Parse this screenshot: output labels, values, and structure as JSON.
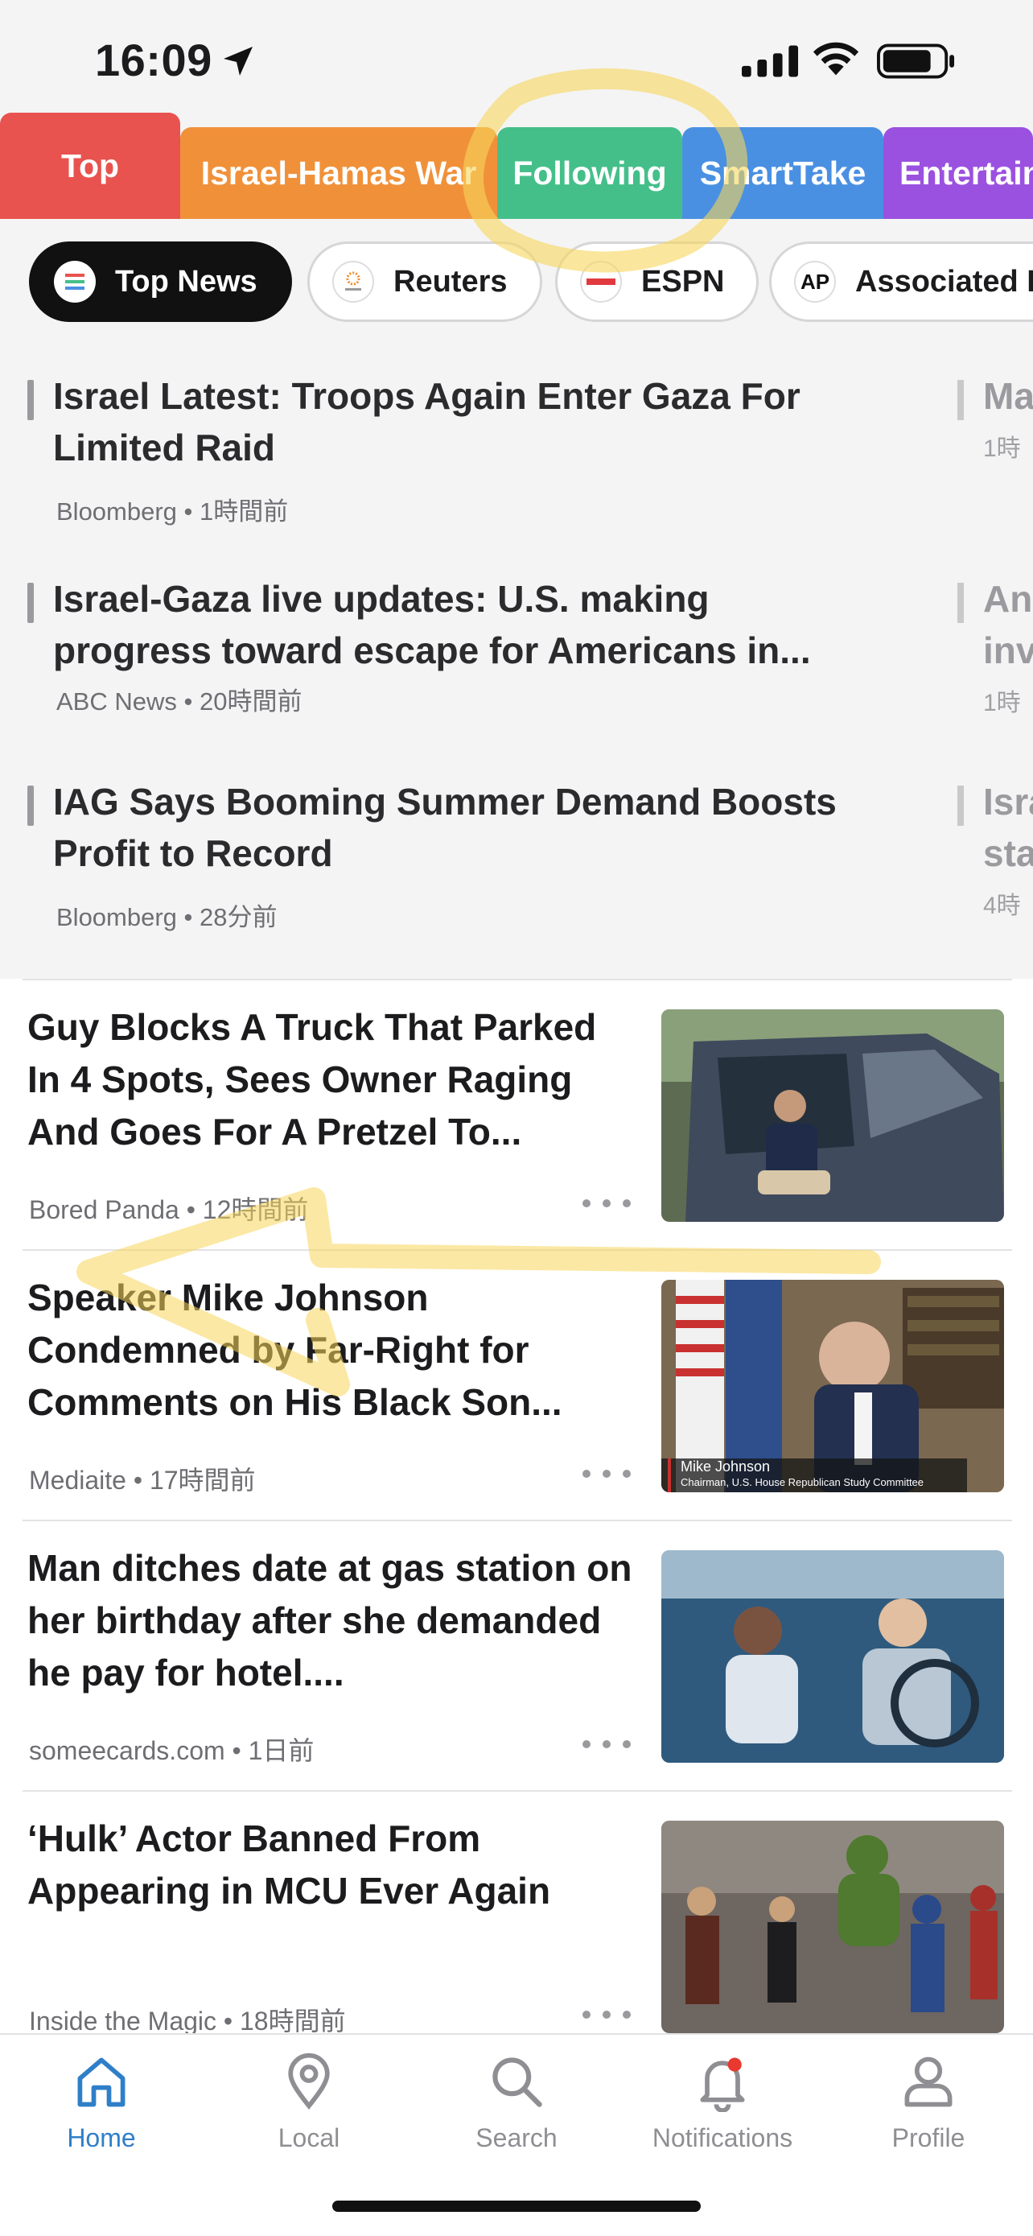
{
  "status_bar": {
    "time": "16:09"
  },
  "categories": [
    {
      "label": "Top",
      "color": "#e8534f"
    },
    {
      "label": "Israel-Hamas War",
      "color": "#f0913a"
    },
    {
      "label": "Following",
      "color": "#45bf8a"
    },
    {
      "label": "SmartTake",
      "color": "#4a90e2"
    },
    {
      "label": "Entertainment",
      "color": "#9b51e0"
    }
  ],
  "sources": [
    {
      "label": "Top News"
    },
    {
      "label": "Reuters"
    },
    {
      "label": "ESPN"
    },
    {
      "label": "Associated Press",
      "logo_text": "AP"
    }
  ],
  "top_headlines": [
    {
      "title": "Israel Latest: Troops Again Enter Gaza For Limited Raid",
      "source": "Bloomberg",
      "time": "1時間前"
    },
    {
      "title": "Israel-Gaza live updates: U.S. making progress toward escape for Americans in...",
      "source": "ABC News",
      "time": "20時間前"
    },
    {
      "title": "IAG Says Booming Summer Demand Boosts Profit to Record",
      "source": "Bloomberg",
      "time": "28分前"
    }
  ],
  "peek_headlines": [
    {
      "title": "Ma",
      "time": "1時"
    },
    {
      "title": "An",
      "title2": "inv",
      "time": "1時"
    },
    {
      "title": "Isra",
      "title2": "sta",
      "time": "4時"
    }
  ],
  "articles": [
    {
      "title": "Guy Blocks A Truck That Parked In 4 Spots, Sees Owner Raging And Goes For A Pretzel To...",
      "source": "Bored Panda",
      "time": "12時間前"
    },
    {
      "title": "Speaker Mike Johnson Condemned by Far-Right for Comments on His Black Son...",
      "source": "Mediaite",
      "time": "17時間前",
      "caption_name": "Mike Johnson",
      "caption_role": "Chairman, U.S. House Republican Study Committee"
    },
    {
      "title": "Man ditches date at gas station on her birthday after she demanded he pay for hotel....",
      "source": "someecards.com",
      "time": "1日前"
    },
    {
      "title": "‘Hulk’ Actor Banned From Appearing in MCU Ever Again",
      "source": "Inside the Magic",
      "time": "18時間前"
    }
  ],
  "tabbar": [
    {
      "label": "Home",
      "icon": "home-icon"
    },
    {
      "label": "Local",
      "icon": "location-pin-icon"
    },
    {
      "label": "Search",
      "icon": "search-icon"
    },
    {
      "label": "Notifications",
      "icon": "bell-icon"
    },
    {
      "label": "Profile",
      "icon": "person-icon"
    }
  ],
  "colors": {
    "accent": "#2f7fc8",
    "annotation": "#f7d65a",
    "notification_dot": "#e8382f"
  }
}
